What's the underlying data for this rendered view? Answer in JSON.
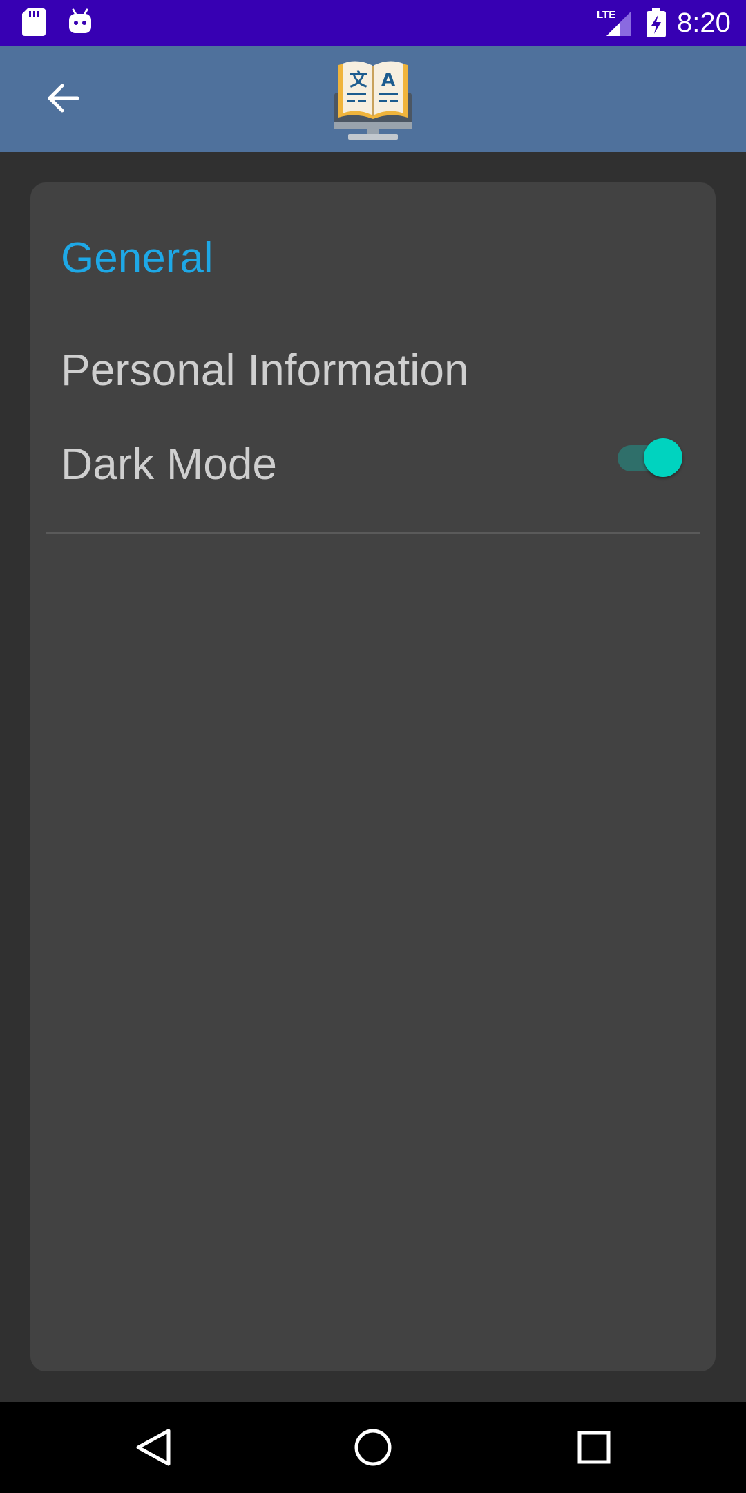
{
  "status_bar": {
    "network_label": "LTE",
    "time": "8:20",
    "icons": [
      "sd-card-icon",
      "android-debug-icon",
      "lte-signal-icon",
      "battery-charging-icon"
    ]
  },
  "app_bar": {
    "back_icon": "arrow-left-icon",
    "logo_icon": "dictionary-computer-logo-icon",
    "color": "#4f719c"
  },
  "settings": {
    "section_title": "General",
    "items": [
      {
        "label": "Personal Information"
      },
      {
        "label": "Dark Mode",
        "toggle": true,
        "state": "on"
      }
    ]
  },
  "nav_bar": {
    "buttons": [
      "back-triangle-icon",
      "home-circle-icon",
      "recents-square-icon"
    ]
  },
  "colors": {
    "status_bar": "#3700b3",
    "background": "#303030",
    "card": "#424242",
    "accent": "#1ea8e6",
    "switch_thumb": "#00d3bf",
    "switch_track": "#2f6f6a"
  }
}
